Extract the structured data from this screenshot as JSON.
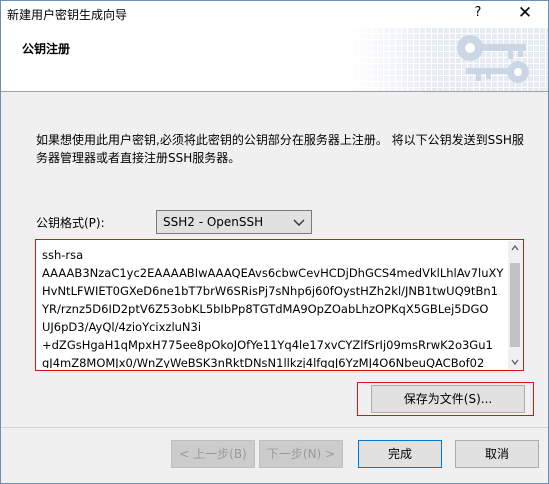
{
  "window": {
    "title": "新建用户密钥生成向导",
    "help_glyph": "?",
    "close_glyph": "✕"
  },
  "header": {
    "title": "公钥注册"
  },
  "description": "如果想使用此用户密钥,必须将此密钥的公钥部分在服务器上注册。 将以下公钥发送到SSH服务器管理器或者直接注册SSH服务器。",
  "format": {
    "label": "公钥格式(P):",
    "selected": "SSH2 - OpenSSH"
  },
  "public_key_text": "ssh-rsa\nAAAAB3NzaC1yc2EAAAABIwAAAQEAvs6cbwCevHCDjDhGCS4medVklLhlAv7luXY\nHvNtLFWIET0GXeD6ne1bT7brW6SRisPj7sNhp6j60fOystHZh2kl/JNB1twUQ9tBn1\nYR/rznz5D6ID2ptV6Z53obKL5bIbPp8TGTdMA9OpZOabLhzOPKqX5GBLej5DGO\nUJ6pD3/AyQl/4zioYcixzluN3i\n+dZGsHgaH1qMpxH775ee8pOkoJOfYe11Yq4le17xvCYZlfSrIj09msRrwK2o3Gu1\ngJ4mZ8MOMJx0/WnZyWeBSK3nRktDNsN1llkzj4lfgqJ6YzMJ4O6NbeuQACBof02",
  "buttons": {
    "save_file": "保存为文件(S)...",
    "back": "< 上一步(B)",
    "next": "下一步(N) >",
    "finish": "完成",
    "cancel": "取消"
  }
}
